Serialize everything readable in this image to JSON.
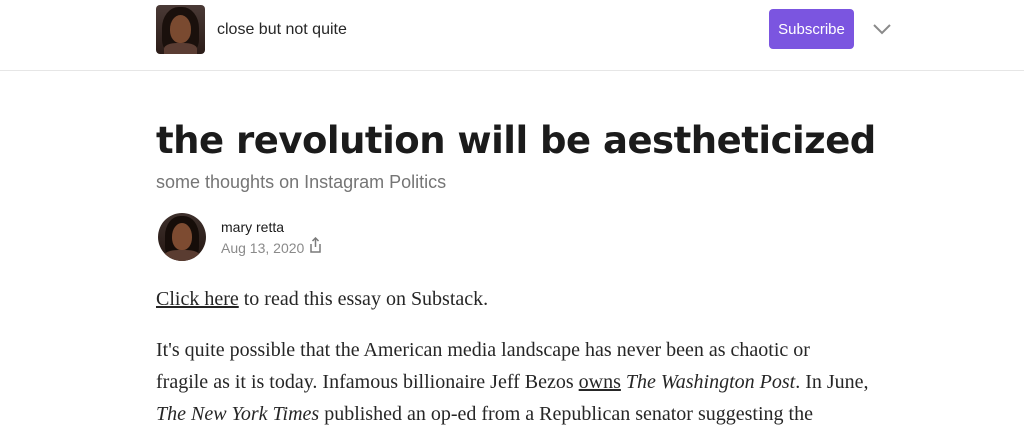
{
  "header": {
    "publication_name": "close but not quite",
    "subscribe_label": "Subscribe",
    "avatar_icon": "publication-avatar",
    "menu_icon": "chevron-down-icon",
    "accent_color": "#7b55e0"
  },
  "article": {
    "title": "the revolution will be aestheticized",
    "subtitle": "some thoughts on Instagram Politics",
    "author": "mary retta",
    "date": "Aug 13, 2020",
    "share_icon": "share-icon",
    "p1": {
      "link_text": "Click here",
      "rest": " to read this essay on Substack."
    },
    "p2": {
      "line1": "It's quite possible that the American media landscape has never been as chaotic or",
      "line2_a": "fragile as it is today. Infamous billionaire Jeff Bezos ",
      "line2_link": "owns",
      "line2_b": " ",
      "line2_ital": "The Washington Post",
      "line2_c": ". In June,",
      "line3_ital": "The New York Times",
      "line3_rest": " published an op-ed from a Republican senator suggesting the"
    }
  }
}
